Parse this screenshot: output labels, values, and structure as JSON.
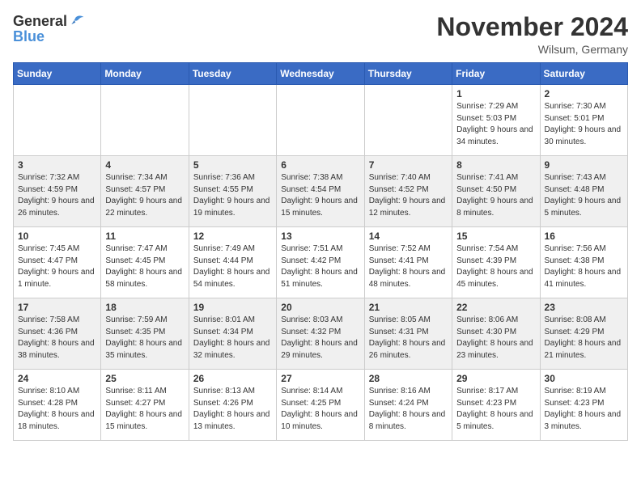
{
  "logo": {
    "general": "General",
    "blue": "Blue"
  },
  "header": {
    "title": "November 2024",
    "location": "Wilsum, Germany"
  },
  "days_of_week": [
    "Sunday",
    "Monday",
    "Tuesday",
    "Wednesday",
    "Thursday",
    "Friday",
    "Saturday"
  ],
  "weeks": [
    [
      {
        "day": "",
        "info": ""
      },
      {
        "day": "",
        "info": ""
      },
      {
        "day": "",
        "info": ""
      },
      {
        "day": "",
        "info": ""
      },
      {
        "day": "",
        "info": ""
      },
      {
        "day": "1",
        "info": "Sunrise: 7:29 AM\nSunset: 5:03 PM\nDaylight: 9 hours and 34 minutes."
      },
      {
        "day": "2",
        "info": "Sunrise: 7:30 AM\nSunset: 5:01 PM\nDaylight: 9 hours and 30 minutes."
      }
    ],
    [
      {
        "day": "3",
        "info": "Sunrise: 7:32 AM\nSunset: 4:59 PM\nDaylight: 9 hours and 26 minutes."
      },
      {
        "day": "4",
        "info": "Sunrise: 7:34 AM\nSunset: 4:57 PM\nDaylight: 9 hours and 22 minutes."
      },
      {
        "day": "5",
        "info": "Sunrise: 7:36 AM\nSunset: 4:55 PM\nDaylight: 9 hours and 19 minutes."
      },
      {
        "day": "6",
        "info": "Sunrise: 7:38 AM\nSunset: 4:54 PM\nDaylight: 9 hours and 15 minutes."
      },
      {
        "day": "7",
        "info": "Sunrise: 7:40 AM\nSunset: 4:52 PM\nDaylight: 9 hours and 12 minutes."
      },
      {
        "day": "8",
        "info": "Sunrise: 7:41 AM\nSunset: 4:50 PM\nDaylight: 9 hours and 8 minutes."
      },
      {
        "day": "9",
        "info": "Sunrise: 7:43 AM\nSunset: 4:48 PM\nDaylight: 9 hours and 5 minutes."
      }
    ],
    [
      {
        "day": "10",
        "info": "Sunrise: 7:45 AM\nSunset: 4:47 PM\nDaylight: 9 hours and 1 minute."
      },
      {
        "day": "11",
        "info": "Sunrise: 7:47 AM\nSunset: 4:45 PM\nDaylight: 8 hours and 58 minutes."
      },
      {
        "day": "12",
        "info": "Sunrise: 7:49 AM\nSunset: 4:44 PM\nDaylight: 8 hours and 54 minutes."
      },
      {
        "day": "13",
        "info": "Sunrise: 7:51 AM\nSunset: 4:42 PM\nDaylight: 8 hours and 51 minutes."
      },
      {
        "day": "14",
        "info": "Sunrise: 7:52 AM\nSunset: 4:41 PM\nDaylight: 8 hours and 48 minutes."
      },
      {
        "day": "15",
        "info": "Sunrise: 7:54 AM\nSunset: 4:39 PM\nDaylight: 8 hours and 45 minutes."
      },
      {
        "day": "16",
        "info": "Sunrise: 7:56 AM\nSunset: 4:38 PM\nDaylight: 8 hours and 41 minutes."
      }
    ],
    [
      {
        "day": "17",
        "info": "Sunrise: 7:58 AM\nSunset: 4:36 PM\nDaylight: 8 hours and 38 minutes."
      },
      {
        "day": "18",
        "info": "Sunrise: 7:59 AM\nSunset: 4:35 PM\nDaylight: 8 hours and 35 minutes."
      },
      {
        "day": "19",
        "info": "Sunrise: 8:01 AM\nSunset: 4:34 PM\nDaylight: 8 hours and 32 minutes."
      },
      {
        "day": "20",
        "info": "Sunrise: 8:03 AM\nSunset: 4:32 PM\nDaylight: 8 hours and 29 minutes."
      },
      {
        "day": "21",
        "info": "Sunrise: 8:05 AM\nSunset: 4:31 PM\nDaylight: 8 hours and 26 minutes."
      },
      {
        "day": "22",
        "info": "Sunrise: 8:06 AM\nSunset: 4:30 PM\nDaylight: 8 hours and 23 minutes."
      },
      {
        "day": "23",
        "info": "Sunrise: 8:08 AM\nSunset: 4:29 PM\nDaylight: 8 hours and 21 minutes."
      }
    ],
    [
      {
        "day": "24",
        "info": "Sunrise: 8:10 AM\nSunset: 4:28 PM\nDaylight: 8 hours and 18 minutes."
      },
      {
        "day": "25",
        "info": "Sunrise: 8:11 AM\nSunset: 4:27 PM\nDaylight: 8 hours and 15 minutes."
      },
      {
        "day": "26",
        "info": "Sunrise: 8:13 AM\nSunset: 4:26 PM\nDaylight: 8 hours and 13 minutes."
      },
      {
        "day": "27",
        "info": "Sunrise: 8:14 AM\nSunset: 4:25 PM\nDaylight: 8 hours and 10 minutes."
      },
      {
        "day": "28",
        "info": "Sunrise: 8:16 AM\nSunset: 4:24 PM\nDaylight: 8 hours and 8 minutes."
      },
      {
        "day": "29",
        "info": "Sunrise: 8:17 AM\nSunset: 4:23 PM\nDaylight: 8 hours and 5 minutes."
      },
      {
        "day": "30",
        "info": "Sunrise: 8:19 AM\nSunset: 4:23 PM\nDaylight: 8 hours and 3 minutes."
      }
    ]
  ]
}
